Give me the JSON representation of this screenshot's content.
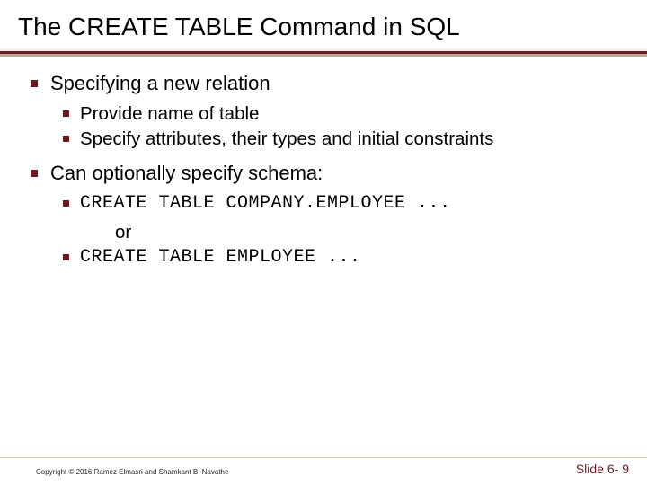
{
  "title": "The CREATE TABLE Command in SQL",
  "bullets": {
    "b1": "Specifying a new relation",
    "b1a": "Provide name of table",
    "b1b": "Specify attributes, their types  and initial constraints",
    "b2": "Can optionally specify schema:",
    "b2a": "CREATE TABLE COMPANY.EMPLOYEE ...",
    "b2or": "or",
    "b2b": "CREATE TABLE EMPLOYEE ..."
  },
  "footer": {
    "copyright": "Copyright © 2016 Ramez Elmasri and Shamkant B. Navathe",
    "slide": "Slide 6- 9"
  }
}
